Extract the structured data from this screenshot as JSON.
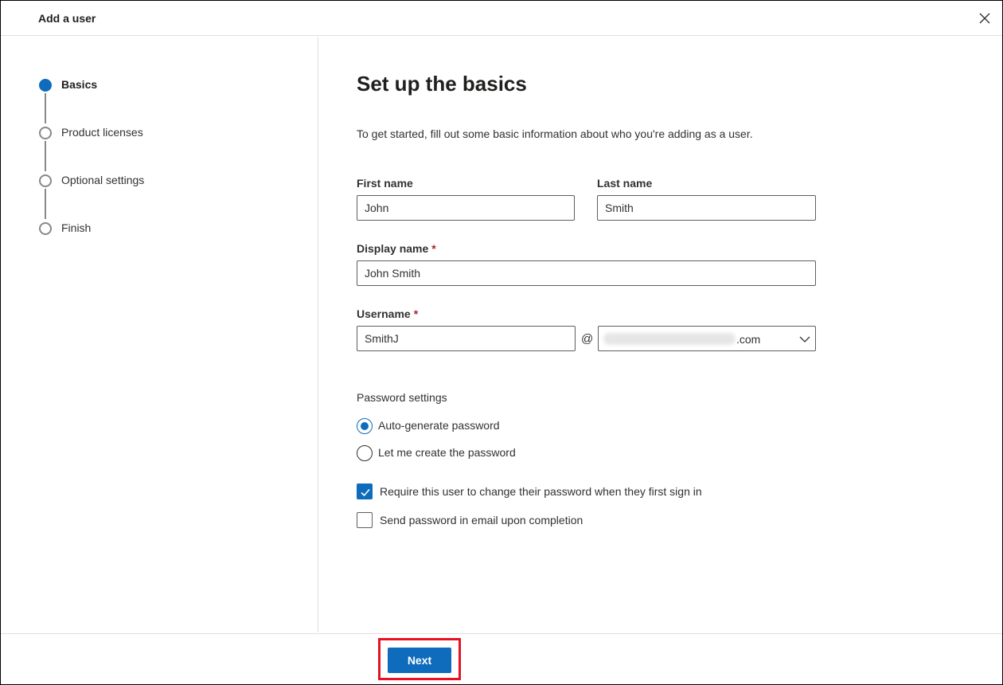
{
  "window": {
    "title": "Add a user",
    "close_icon": "close-icon"
  },
  "steps": [
    {
      "label": "Basics",
      "state": "current"
    },
    {
      "label": "Product licenses",
      "state": "pending"
    },
    {
      "label": "Optional settings",
      "state": "pending"
    },
    {
      "label": "Finish",
      "state": "pending"
    }
  ],
  "main": {
    "heading": "Set up the basics",
    "intro": "To get started, fill out some basic information about who you're adding as a user."
  },
  "form": {
    "first_name": {
      "label": "First name",
      "value": "John"
    },
    "last_name": {
      "label": "Last name",
      "value": "Smith"
    },
    "display_name": {
      "label": "Display name",
      "required_mark": "*",
      "value": "John Smith"
    },
    "username": {
      "label": "Username",
      "required_mark": "*",
      "value": "SmithJ",
      "at": "@",
      "domain_suffix": ".com"
    }
  },
  "password": {
    "section_label": "Password settings",
    "options": [
      {
        "label": "Auto-generate password",
        "selected": true
      },
      {
        "label": "Let me create the password",
        "selected": false
      }
    ],
    "require_change": {
      "label": "Require this user to change their password when they first sign in",
      "checked": true
    },
    "send_email": {
      "label": "Send password in email upon completion",
      "checked": false
    }
  },
  "footer": {
    "next_label": "Next"
  },
  "colors": {
    "accent": "#0f6cbd",
    "highlight": "#e81123",
    "required": "#a4262c"
  }
}
